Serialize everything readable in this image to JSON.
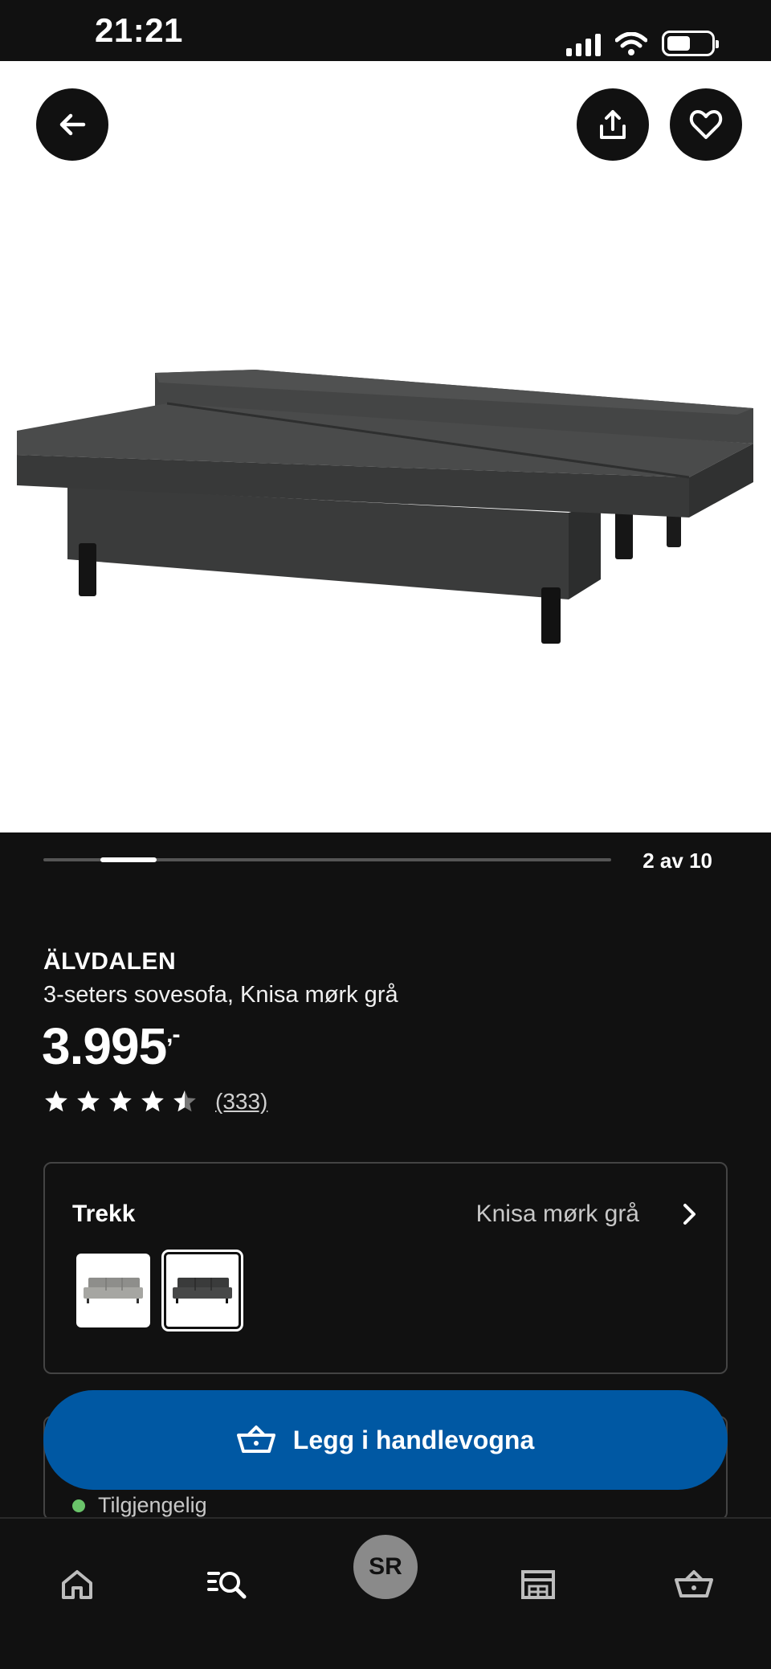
{
  "status_bar": {
    "time": "21:21"
  },
  "gallery": {
    "counter": "2 av 10",
    "current": 2,
    "total": 10
  },
  "product": {
    "name": "ÄLVDALEN",
    "description": "3-seters sovesofa, Knisa mørk grå",
    "price": "3.995",
    "price_suffix": ",-",
    "rating": 4.5,
    "review_count": "(333)"
  },
  "variant": {
    "label": "Trekk",
    "value": "Knisa mørk grå",
    "options": [
      "light-grey-sofa",
      "dark-grey-sofa"
    ],
    "selected_index": 1
  },
  "availability": {
    "status": "Tilgjengelig",
    "color": "#6ac46a"
  },
  "cart_button": {
    "label": "Legg i handlevogna"
  },
  "nav": {
    "items": [
      "home-icon",
      "search-list-icon",
      "profile-avatar",
      "store-icon",
      "cart-icon"
    ],
    "avatar_initials": "SR"
  },
  "colors": {
    "accent": "#0058a3",
    "background": "#111111"
  }
}
